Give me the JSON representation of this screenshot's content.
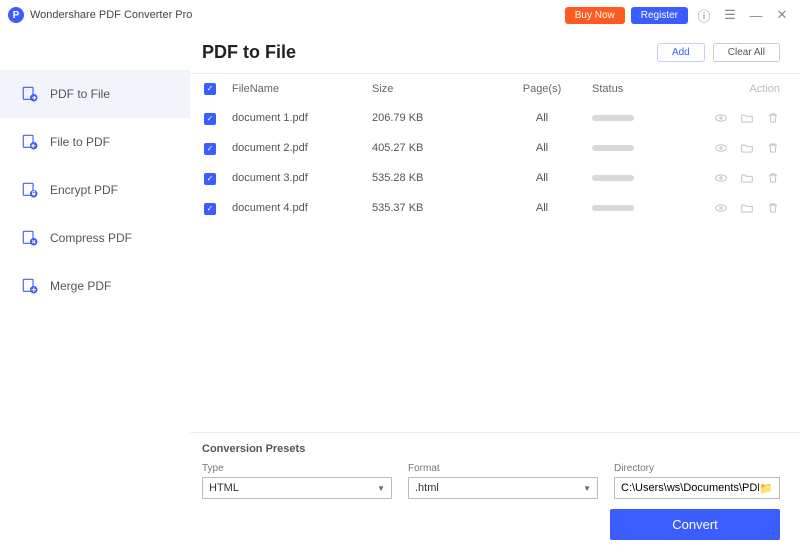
{
  "titlebar": {
    "app_name": "Wondershare PDF Converter Pro",
    "buy_label": "Buy Now",
    "register_label": "Register"
  },
  "sidebar": {
    "items": [
      {
        "label": "PDF to File"
      },
      {
        "label": "File to PDF"
      },
      {
        "label": "Encrypt PDF"
      },
      {
        "label": "Compress PDF"
      },
      {
        "label": "Merge PDF"
      }
    ]
  },
  "main": {
    "title": "PDF to File",
    "add_label": "Add",
    "clear_label": "Clear All",
    "columns": {
      "filename": "FileName",
      "size": "Size",
      "pages": "Page(s)",
      "status": "Status",
      "action": "Action"
    },
    "rows": [
      {
        "filename": "document 1.pdf",
        "size": "206.79 KB",
        "pages": "All"
      },
      {
        "filename": "document 2.pdf",
        "size": "405.27 KB",
        "pages": "All"
      },
      {
        "filename": "document 3.pdf",
        "size": "535.28 KB",
        "pages": "All"
      },
      {
        "filename": "document 4.pdf",
        "size": "535.37 KB",
        "pages": "All"
      }
    ]
  },
  "presets": {
    "title": "Conversion Presets",
    "type_label": "Type",
    "type_value": "HTML",
    "format_label": "Format",
    "format_value": ".html",
    "directory_label": "Directory",
    "directory_value": "C:\\Users\\ws\\Documents\\PDFConvert",
    "convert_label": "Convert"
  }
}
